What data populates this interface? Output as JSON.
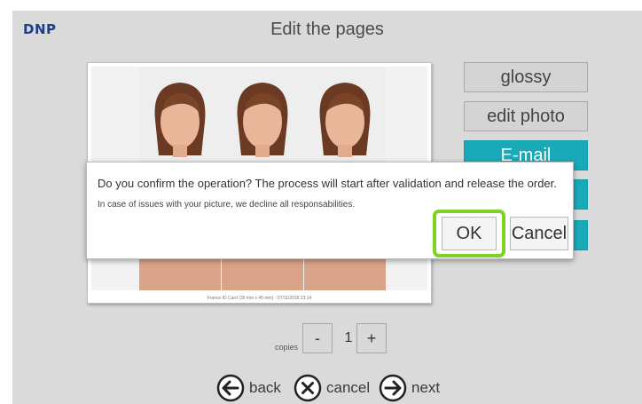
{
  "brand": {
    "logo": "DNP"
  },
  "header": {
    "title": "Edit the pages"
  },
  "preview": {
    "caption": "France ID Card (35 mm x 45 mm) - 07/11/2018 23:14"
  },
  "side_buttons": {
    "glossy": "glossy",
    "edit_photo": "edit photo",
    "email": "E-mail"
  },
  "dialog": {
    "message": "Do you confirm the operation? The process will start after validation and release the order.",
    "disclaimer": "In case of issues with your picture, we decline all responsabilities.",
    "ok_label": "OK",
    "cancel_label": "Cancel"
  },
  "copies": {
    "label": "copies",
    "minus": "-",
    "value": "1",
    "plus": "+"
  },
  "nav": {
    "back": "back",
    "cancel": "cancel",
    "next": "next"
  },
  "colors": {
    "accent_teal": "#19aab8",
    "highlight_green": "#7ed321",
    "logo_blue": "#1c3f8c"
  },
  "icons": [
    "arrow-left-icon",
    "close-circle-icon",
    "arrow-right-icon"
  ]
}
